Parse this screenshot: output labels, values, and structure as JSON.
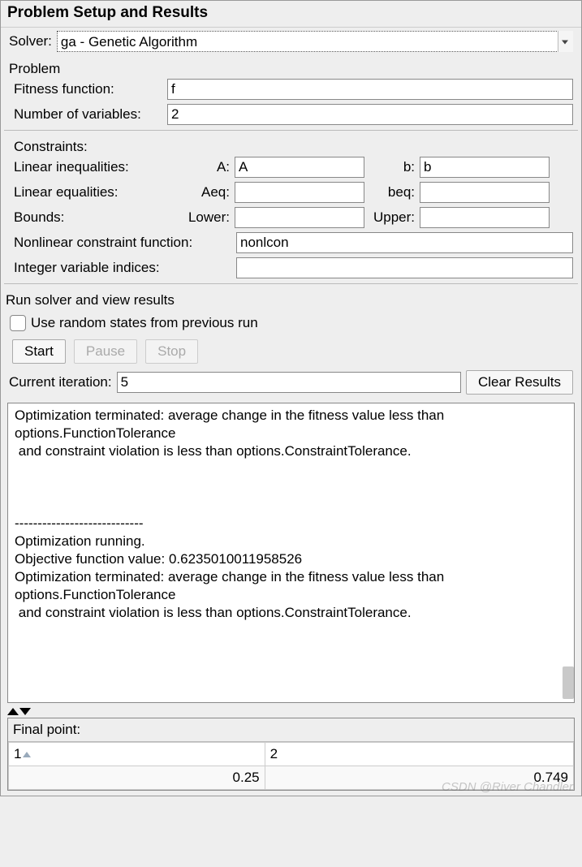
{
  "title": "Problem Setup and Results",
  "solver": {
    "label": "Solver:",
    "value": "ga - Genetic Algorithm"
  },
  "problem": {
    "group_label": "Problem",
    "fitness_label": "Fitness function:",
    "fitness_value": "f",
    "numvars_label": "Number of variables:",
    "numvars_value": "2"
  },
  "constraints": {
    "group_label": "Constraints:",
    "ineq_label": "Linear inequalities:",
    "ineq_A_prefix": "A:",
    "ineq_A_value": "A",
    "ineq_b_prefix": "b:",
    "ineq_b_value": "b",
    "eq_label": "Linear equalities:",
    "eq_Aeq_prefix": "Aeq:",
    "eq_Aeq_value": "",
    "eq_beq_prefix": "beq:",
    "eq_beq_value": "",
    "bounds_label": "Bounds:",
    "bounds_lower_prefix": "Lower:",
    "bounds_lower_value": "",
    "bounds_upper_prefix": "Upper:",
    "bounds_upper_value": "",
    "nonlcon_label": "Nonlinear constraint function:",
    "nonlcon_value": "nonlcon",
    "intvar_label": "Integer variable indices:",
    "intvar_value": ""
  },
  "run": {
    "group_label": "Run solver and view results",
    "checkbox_label": "Use random states from previous run",
    "checkbox_checked": false,
    "start_label": "Start",
    "pause_label": "Pause",
    "stop_label": "Stop",
    "iter_label": "Current iteration:",
    "iter_value": "5",
    "clear_label": "Clear Results"
  },
  "results_text": "Optimization terminated: average change in the fitness value less than options.FunctionTolerance\n and constraint violation is less than options.ConstraintTolerance.\n\n\n\n----------------------------\nOptimization running.\nObjective function value: 0.6235010011958526\nOptimization terminated: average change in the fitness value less than options.FunctionTolerance\n and constraint violation is less than options.ConstraintTolerance.",
  "final_point": {
    "label": "Final point:",
    "headers": [
      "1",
      "2"
    ],
    "values": [
      "0.25",
      "0.749"
    ]
  },
  "watermark": "CSDN @River Chandler"
}
